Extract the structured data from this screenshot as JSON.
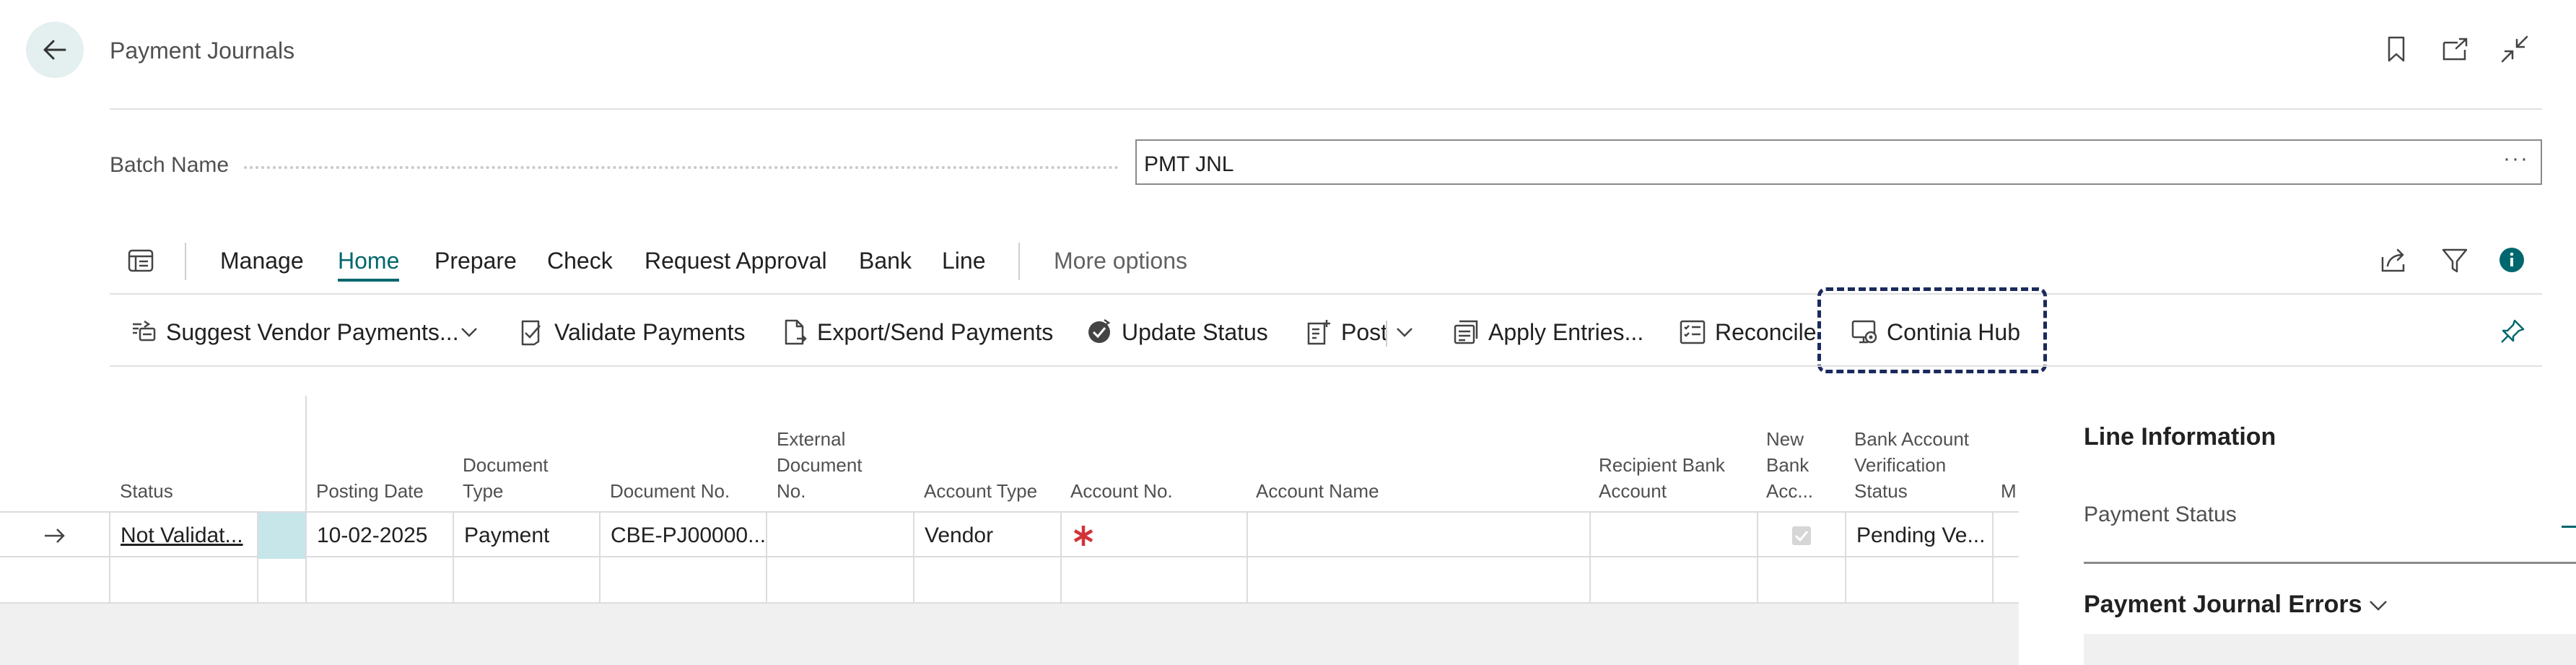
{
  "header": {
    "title": "Payment Journals",
    "icons": [
      "back-arrow-icon",
      "bookmark-icon",
      "open-new-window-icon",
      "collapse-icon"
    ]
  },
  "batch": {
    "label": "Batch Name",
    "value": "PMT JNL",
    "more": "···"
  },
  "menu": {
    "items": [
      {
        "label": "Manage"
      },
      {
        "label": "Home",
        "active": true
      },
      {
        "label": "Prepare"
      },
      {
        "label": "Check"
      },
      {
        "label": "Request Approval"
      },
      {
        "label": "Bank"
      },
      {
        "label": "Line"
      }
    ],
    "more": "More options"
  },
  "actions": [
    {
      "label": "Suggest Vendor Payments...",
      "icon": "suggest-payments-icon",
      "dropdown": true
    },
    {
      "label": "Validate Payments",
      "icon": "validate-icon"
    },
    {
      "label": "Export/Send Payments",
      "icon": "export-file-icon"
    },
    {
      "label": "Update Status",
      "icon": "update-status-icon"
    },
    {
      "label": "Post",
      "icon": "post-icon",
      "dropdown": true
    },
    {
      "label": "Apply Entries...",
      "icon": "apply-entries-icon"
    },
    {
      "label": "Reconcile",
      "icon": "reconcile-icon"
    },
    {
      "label": "Continia Hub",
      "icon": "continia-hub-icon",
      "highlighted": true
    }
  ],
  "grid": {
    "columns": [
      "Status",
      "Posting Date",
      "Document Type",
      "Document No.",
      "External Document No.",
      "Account Type",
      "Account No.",
      "Account Name",
      "Recipient Bank Account",
      "New Bank Acc...",
      "Bank Account Verification Status",
      "M"
    ],
    "rows": [
      {
        "status": "Not Validat...",
        "posting_date": "10-02-2025",
        "document_type": "Payment",
        "document_no": "CBE-PJ00000...",
        "external_document_no": "",
        "account_type": "Vendor",
        "account_no": "",
        "account_name": "",
        "recipient_bank_account": "",
        "new_bank_account": true,
        "verification_status": "Pending Ve..."
      }
    ]
  },
  "side_panel": {
    "title": "Line Information",
    "payment_status_label": "Payment Status",
    "errors_title": "Payment Journal Errors"
  },
  "colors": {
    "accent": "#00676e",
    "required": "#d13438",
    "highlight_border": "#1b2a5c",
    "selected_cell": "#c7e6ea"
  }
}
